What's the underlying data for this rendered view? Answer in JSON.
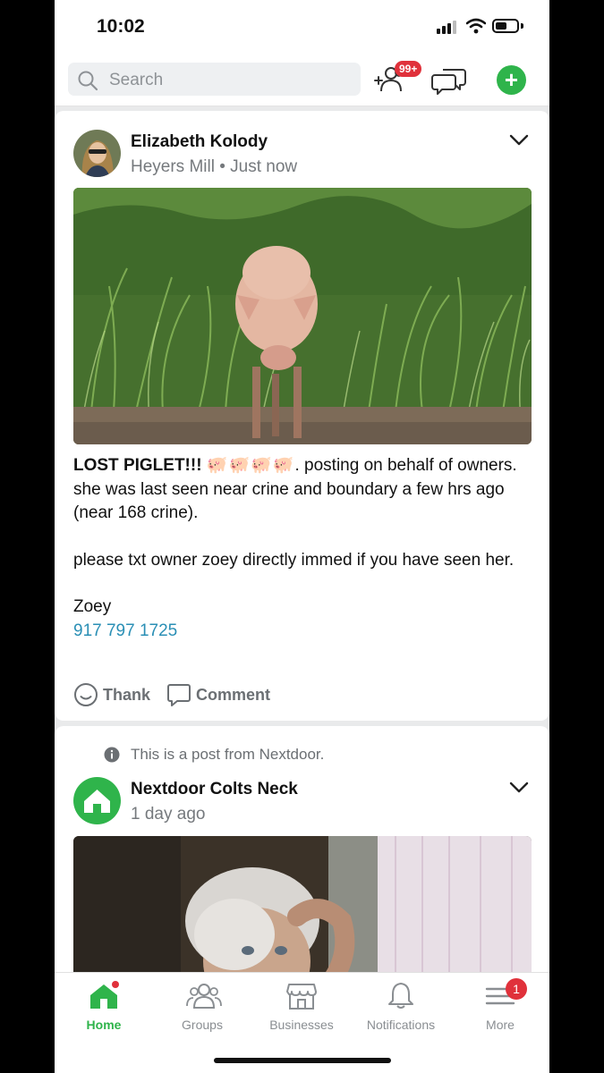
{
  "status_bar": {
    "time": "10:02"
  },
  "search": {
    "placeholder": "Search"
  },
  "header": {
    "neighbors_badge": "99+"
  },
  "post1": {
    "author": "Elizabeth Kolody",
    "neighborhood": "Heyers Mill",
    "separator": " • ",
    "time": "Just now",
    "headline": "LOST PIGLET!!!",
    "pig_emojis": "🐖🐖🐖🐖",
    "line1_rest": ". posting on behalf of owners. she was last seen near crine and boundary a few hrs ago (near 168 crine).",
    "para2": "please txt owner zoey directly immed if you have seen her.",
    "signature": "Zoey",
    "phone": "917 797 1725",
    "thank_label": "Thank",
    "comment_label": "Comment"
  },
  "post2": {
    "sponsored_note": "This is a post from Nextdoor.",
    "author": "Nextdoor Colts Neck",
    "time": "1 day ago"
  },
  "nav": {
    "home": "Home",
    "groups": "Groups",
    "businesses": "Businesses",
    "notifications": "Notifications",
    "more": "More",
    "more_badge": "1"
  },
  "colors": {
    "brand_green": "#2fb44b",
    "badge_red": "#e0313b",
    "link_blue": "#2a8fb5"
  }
}
